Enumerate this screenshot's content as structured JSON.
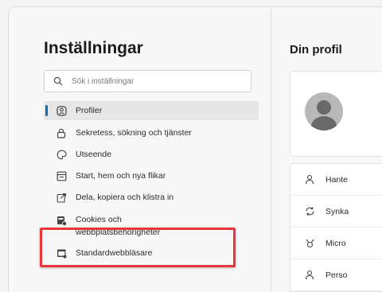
{
  "sidebar": {
    "title": "Inställningar",
    "search_placeholder": "Sök i inställningar",
    "items": [
      {
        "label": "Profiler",
        "icon": "profile-icon"
      },
      {
        "label": "Sekretess, sökning och tjänster",
        "icon": "lock-icon"
      },
      {
        "label": "Utseende",
        "icon": "appearance-icon"
      },
      {
        "label": "Start, hem och nya flikar",
        "icon": "start-tab-icon"
      },
      {
        "label": "Dela, kopiera och klistra in",
        "icon": "share-icon"
      },
      {
        "label_line1": "Cookies och",
        "label_line2": "webbplatsbehörigheter",
        "icon": "cookies-icon"
      },
      {
        "label": "Standardwebbläsare",
        "icon": "default-browser-icon"
      }
    ]
  },
  "main": {
    "title": "Din profil",
    "items": [
      {
        "label": "Hante",
        "icon": "person-icon"
      },
      {
        "label": "Synka",
        "icon": "sync-icon"
      },
      {
        "label": "Micro",
        "icon": "rewards-icon"
      },
      {
        "label": "Perso",
        "icon": "person-icon"
      }
    ]
  },
  "colors": {
    "accent": "#0f6cbd",
    "highlight": "#e8363c"
  }
}
